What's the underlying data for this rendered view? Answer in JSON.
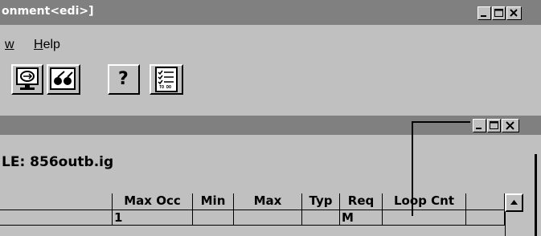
{
  "window": {
    "title": "onment<edi>]"
  },
  "menu": {
    "items": [
      "w",
      "Help"
    ]
  },
  "toolbar": {
    "buttons": [
      "monitor-icon",
      "glasses-icon",
      "help-icon",
      "todo-icon"
    ],
    "help_glyph": "?",
    "todo_caption": "TO DO"
  },
  "child": {
    "file_label": "LE: 856outb.ig"
  },
  "grid": {
    "headers": [
      "",
      "Max Occ",
      "Min",
      "Max",
      "Typ",
      "Req",
      "Loop Cnt",
      ""
    ],
    "rows": [
      [
        "",
        "1",
        "",
        "",
        "",
        "M",
        "",
        ""
      ]
    ]
  }
}
